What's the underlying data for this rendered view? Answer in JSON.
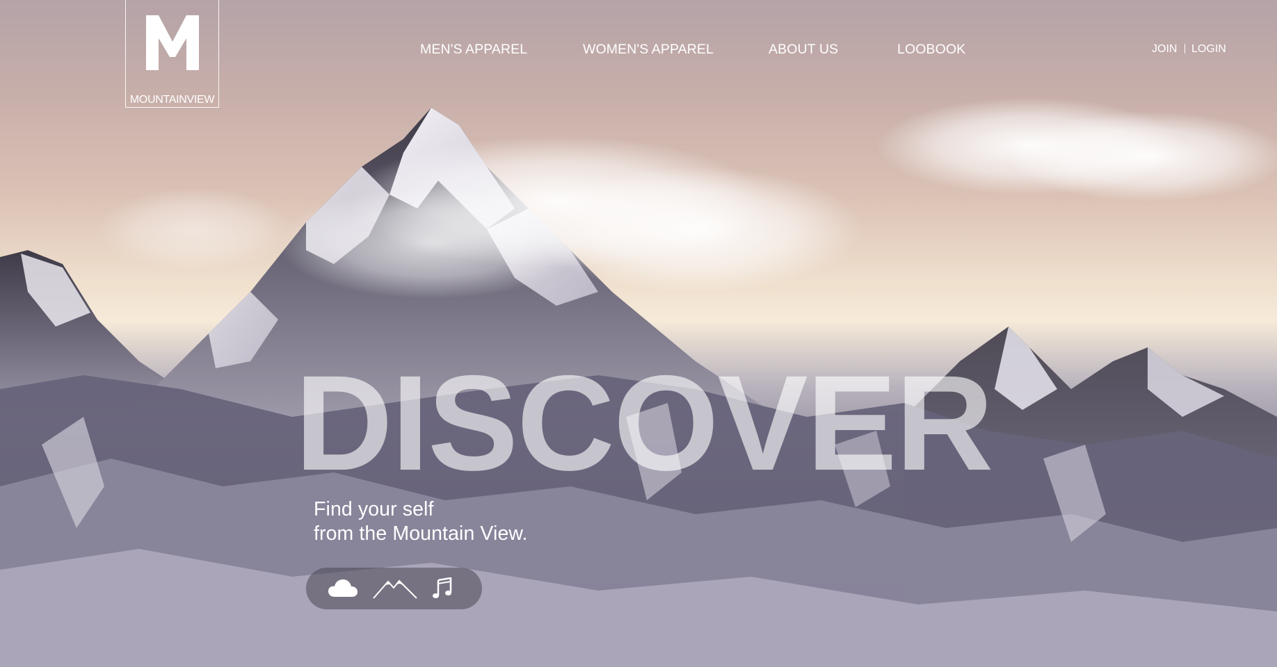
{
  "brand": {
    "letter": "M",
    "name": "MOUNTAINVIEW"
  },
  "nav": {
    "items": [
      {
        "label": "MEN'S APPAREL"
      },
      {
        "label": "WOMEN'S APPAREL"
      },
      {
        "label": "ABOUT US"
      },
      {
        "label": "LOOBOOK"
      }
    ]
  },
  "auth": {
    "join": "JOIN",
    "login": "LOGIN"
  },
  "hero": {
    "headline": "DISCOVER",
    "tagline_line1": "Find your self",
    "tagline_line2": "from the Mountain View."
  },
  "icons": [
    "cloud-icon",
    "mountain-icon",
    "music-note-icon"
  ],
  "colors": {
    "text": "#ffffff",
    "sky_top": "#b5a3a8",
    "sky_horizon": "#f6ead8",
    "mountain_dark": "#4a4754"
  }
}
